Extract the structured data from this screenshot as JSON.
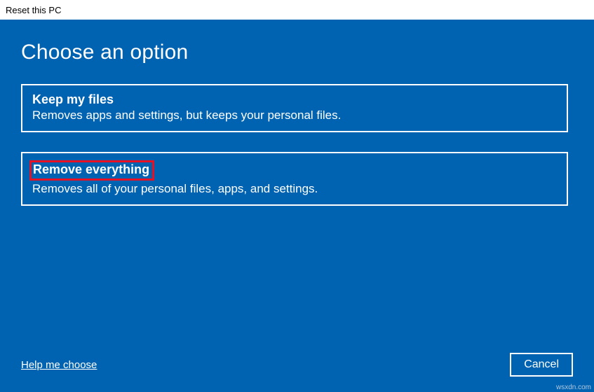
{
  "titlebar": {
    "title": "Reset this PC"
  },
  "main": {
    "heading": "Choose an option",
    "options": [
      {
        "title": "Keep my files",
        "description": "Removes apps and settings, but keeps your personal files."
      },
      {
        "title": "Remove everything",
        "description": "Removes all of your personal files, apps, and settings."
      }
    ]
  },
  "footer": {
    "help_link": "Help me choose",
    "cancel_label": "Cancel"
  },
  "watermark": "wsxdn.com"
}
